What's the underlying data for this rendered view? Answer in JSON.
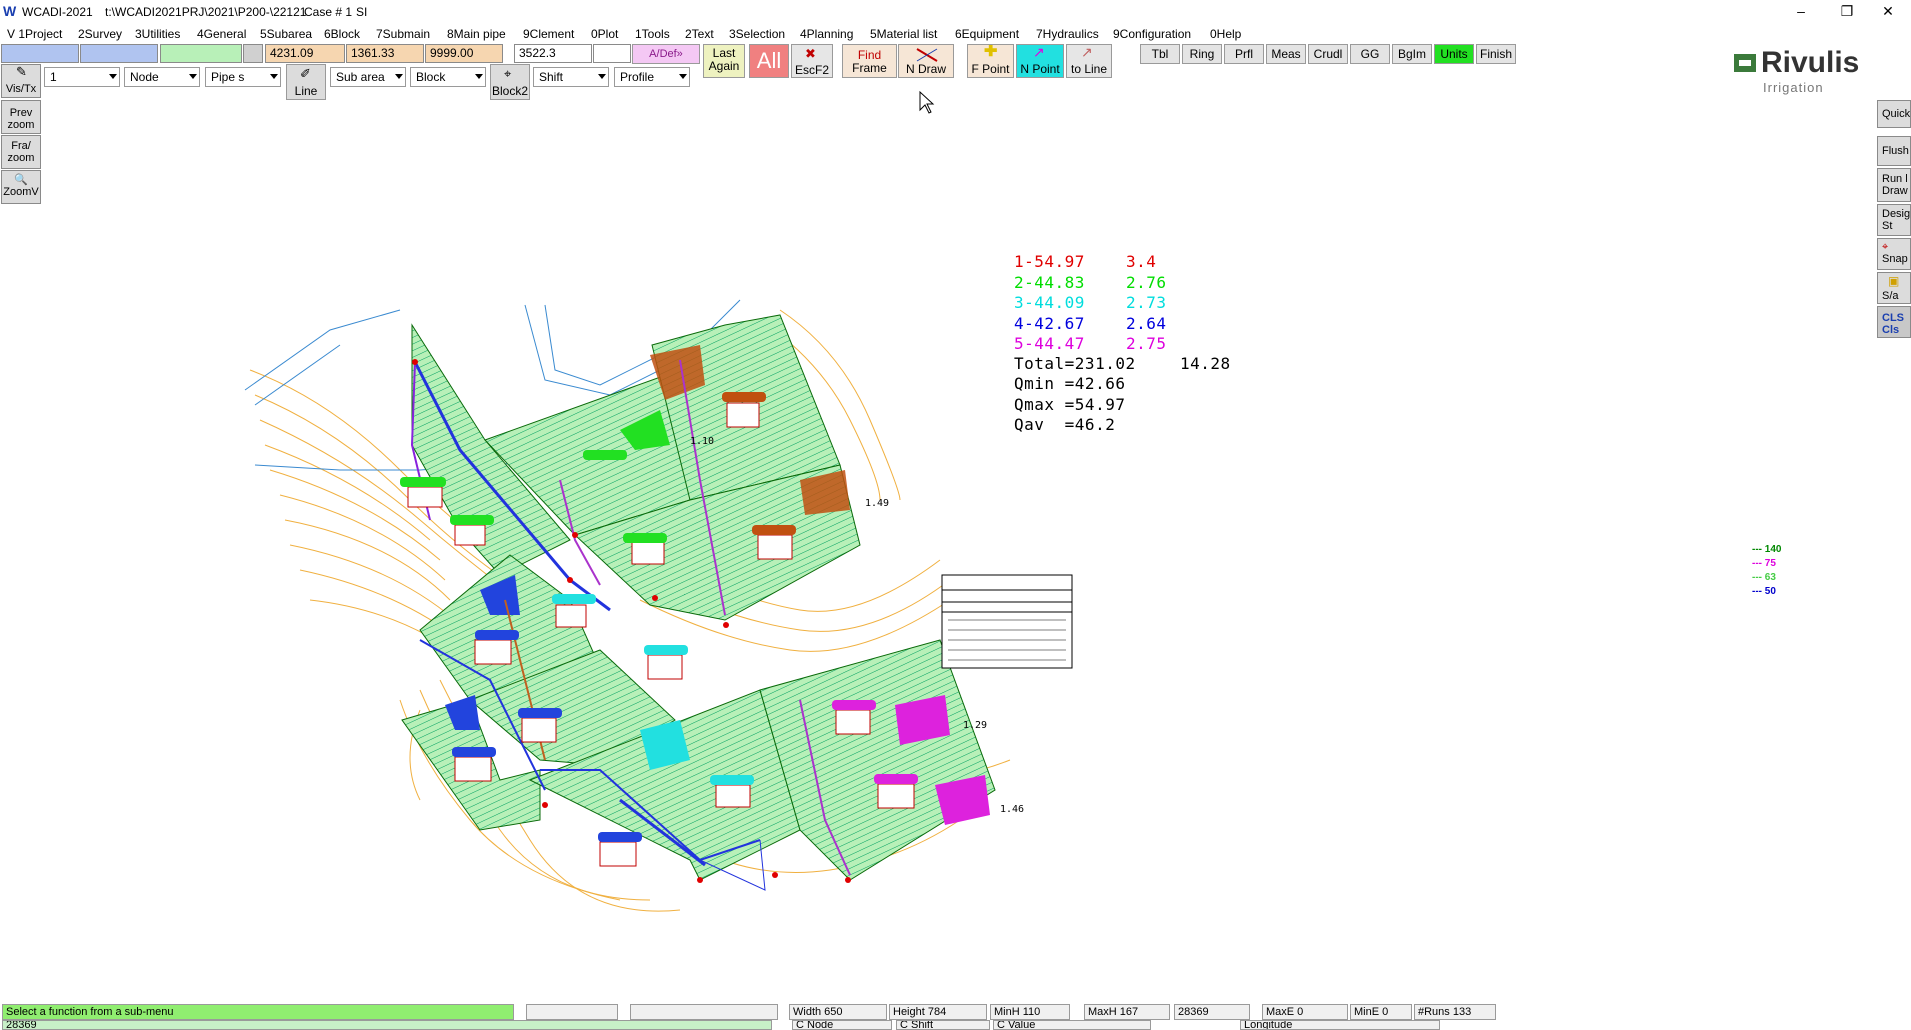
{
  "window": {
    "app_name": "WCADI-2021",
    "path": "t:\\WCADI2021PRJ\\2021\\P200-\\22121",
    "case": "Case # 1",
    "units": "SI",
    "minimize_glyph": "–",
    "restore_glyph": "❐",
    "close_glyph": "✕"
  },
  "menu": [
    "V 1Project",
    "2Survey",
    "3Utilities",
    "4General",
    "5Subarea",
    "6Block",
    "7Submain",
    "8Main pipe",
    "9Clement",
    "0Plot",
    "1Tools",
    "2Text",
    "3Selection",
    "4Planning",
    "5Material list",
    "6Equipment",
    "7Hydraulics",
    "9Configuration",
    "0Help"
  ],
  "toolbar": {
    "coords": [
      "4231.09",
      "1361.33",
      "9999.00",
      "3522.3"
    ],
    "adef": "A/Def»",
    "last_again": [
      "Last",
      "Again"
    ],
    "all": "All",
    "escf2": "EscF2",
    "find_frame": [
      "Find",
      "Frame"
    ],
    "n_draw": "N Draw",
    "f_point": "F Point",
    "n_point": "N Point",
    "to_line": "to Line",
    "small_buttons": [
      "Tbl",
      "Ring",
      "Prfl",
      "Meas",
      "Crudl",
      "GG",
      "BgIm",
      "Units",
      "Finish"
    ]
  },
  "toolbar2": {
    "vis_tx": "Vis/Tx",
    "combo_level": "1",
    "combo_node": "Node",
    "combo_pipe": "Pipe s",
    "line_btn": "Line",
    "combo_subarea": "Sub area",
    "combo_block": "Block",
    "block2_btn": "Block2",
    "combo_shift": "Shift",
    "combo_profile": "Profile"
  },
  "left_buttons": [
    {
      "l1": "Prev",
      "l2": "zoom"
    },
    {
      "l1": "Fra/",
      "l2": "zoom"
    },
    {
      "l1": "🔍",
      "l2": "ZoomV"
    }
  ],
  "right_buttons": [
    "Quick",
    "Flush",
    "Run l",
    "Draw",
    "Desig",
    "St",
    "⌖",
    "Snap",
    "S/a",
    "CLS",
    "Cls"
  ],
  "logo": {
    "name": "Rivulis",
    "tag": "Irrigation"
  },
  "flows": [
    {
      "label": "1-54.97",
      "value": "3.4",
      "color": "#e00000"
    },
    {
      "label": "2-44.83",
      "value": "2.76",
      "color": "#00dd00"
    },
    {
      "label": "3-44.09",
      "value": "2.73",
      "color": "#00dddd"
    },
    {
      "label": "4-42.67",
      "value": "2.64",
      "color": "#0000dd"
    },
    {
      "label": "5-44.47",
      "value": "2.75",
      "color": "#dd00dd"
    }
  ],
  "totals": {
    "total": "Total=231.02",
    "total_value": "14.28",
    "qmin": "Qmin =42.66",
    "qmax": "Qmax =54.97",
    "qav": "Qav  =46.2"
  },
  "pressure_legend": [
    {
      "label": "140",
      "color": "#008800"
    },
    {
      "label": "75",
      "color": "#dd00dd"
    },
    {
      "label": "63",
      "color": "#44cc44"
    },
    {
      "label": "50",
      "color": "#0000cc"
    }
  ],
  "map_labels": [
    "1.49",
    "1.29",
    "1.46",
    "1.10"
  ],
  "status": {
    "message": "Select a function from a sub-menu",
    "width": "Width   650",
    "height": "Height   784",
    "minh": "MinH    110",
    "maxh": "MaxH    167",
    "val": "28369",
    "maxe": "MaxE    0",
    "mine": "MinE    0",
    "runs": "#Runs  133",
    "bottom_value": "28369",
    "c_node": "C Node",
    "c_shift": "C Shift",
    "c_value": "C Value",
    "longitude": "Longitude"
  }
}
